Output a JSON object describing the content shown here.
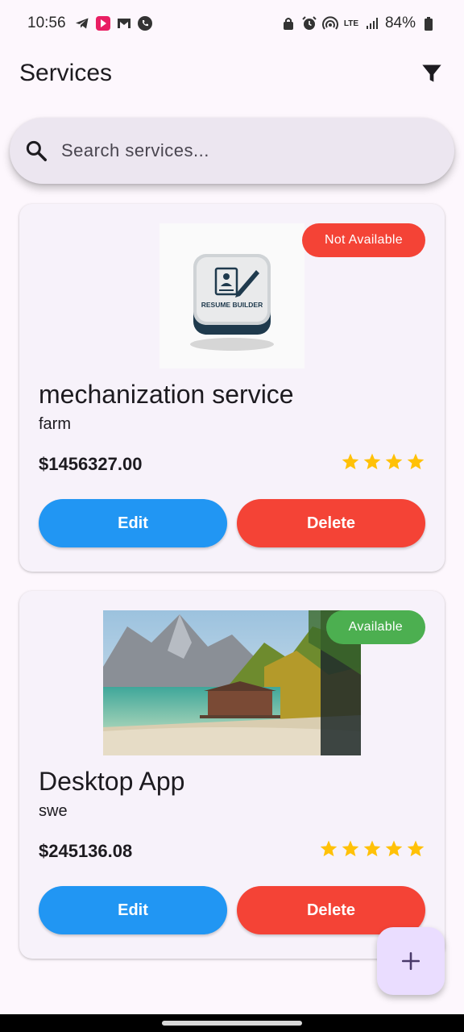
{
  "status_bar": {
    "time": "10:56",
    "battery": "84%",
    "network": "LTE",
    "left_icons": [
      "telegram-icon",
      "app-icon",
      "gmail-icon",
      "phone-icon"
    ],
    "right_icons": [
      "lock-icon",
      "alarm-icon",
      "hotspot-icon",
      "lte-icon",
      "signal-icon",
      "battery-icon"
    ]
  },
  "app_bar": {
    "title": "Services",
    "filter_icon": "filter-icon"
  },
  "search": {
    "placeholder": "Search services...",
    "value": "",
    "icon": "search-icon"
  },
  "services": [
    {
      "title": "mechanization service",
      "category": "farm",
      "price": "$1456327.00",
      "rating": 4,
      "status": "Not Available",
      "status_color": "#f44336",
      "image": {
        "kind": "app-icon",
        "label": "RESUME BUILDER"
      },
      "edit_label": "Edit",
      "delete_label": "Delete"
    },
    {
      "title": "Desktop App",
      "category": "swe",
      "price": "$245136.08",
      "rating": 5,
      "status": "Available",
      "status_color": "#4caf50",
      "image": {
        "kind": "landscape-photo"
      },
      "edit_label": "Edit",
      "delete_label": "Delete"
    }
  ],
  "colors": {
    "edit": "#2196f3",
    "delete": "#f44336",
    "star": "#ffc107",
    "fab": "#eaddff"
  },
  "fab": {
    "icon": "plus-icon"
  }
}
